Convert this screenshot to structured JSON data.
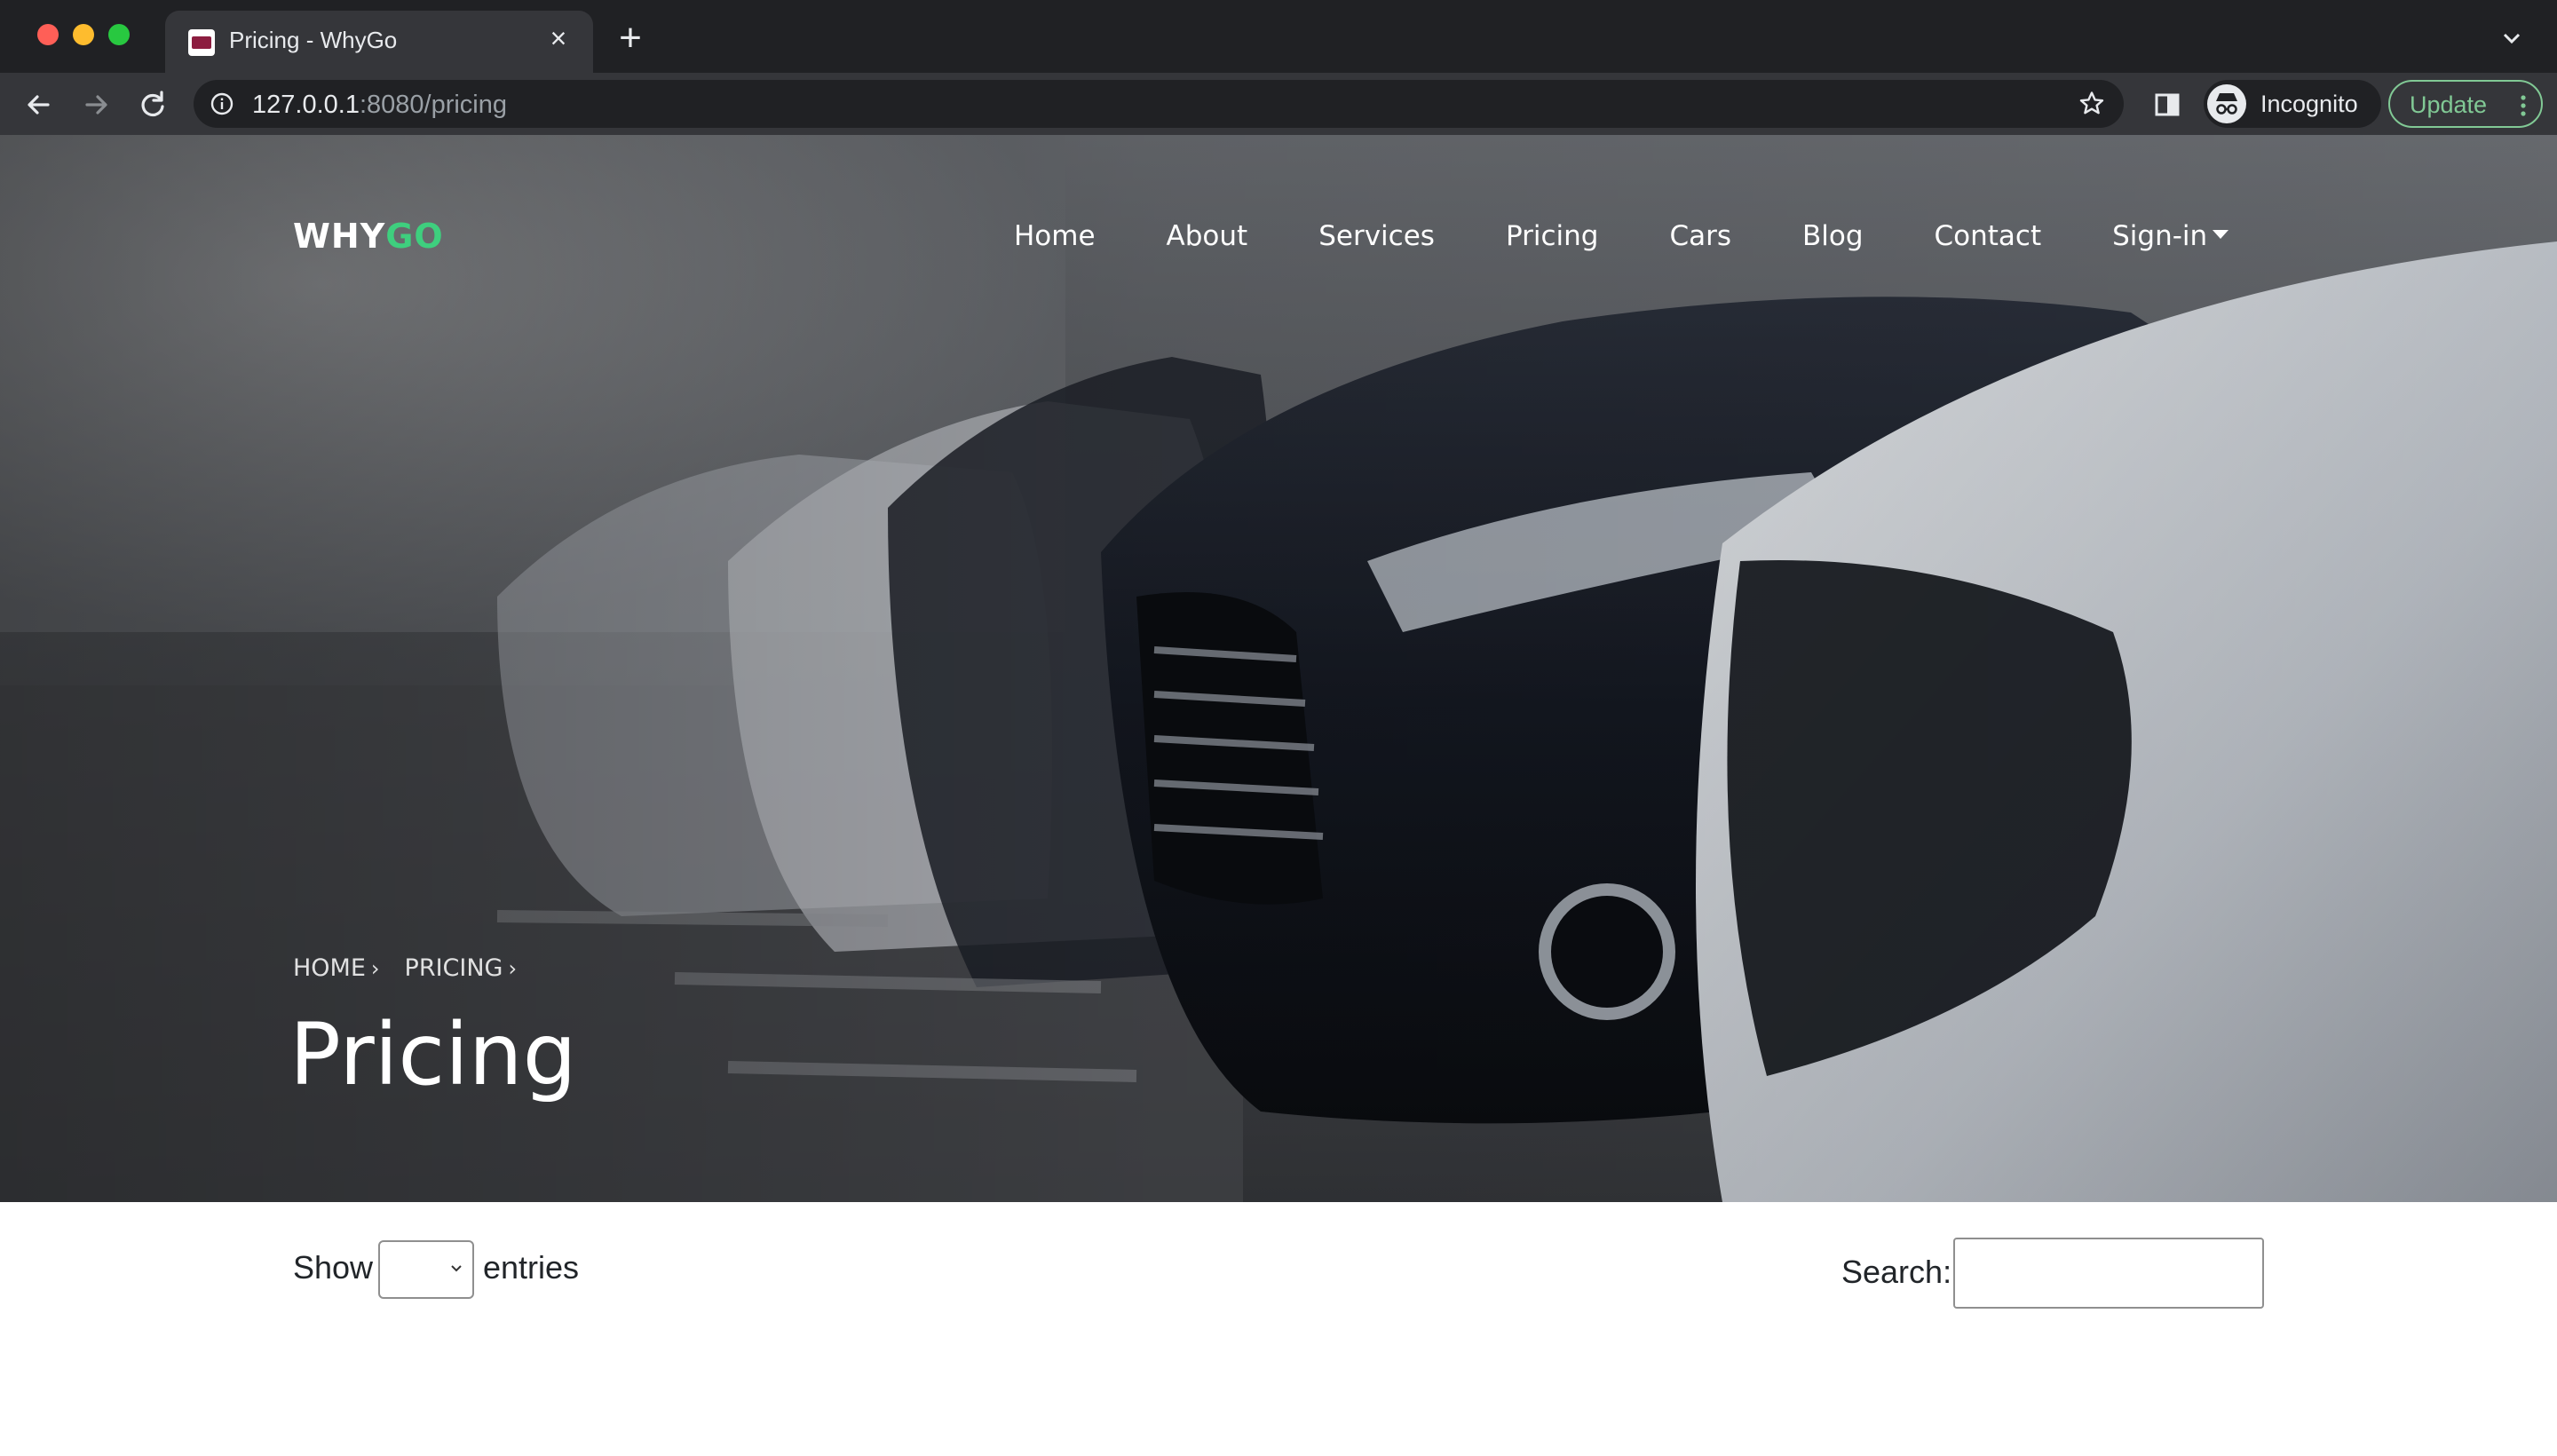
{
  "browser": {
    "tab_title": "Pricing - WhyGo",
    "url_host": "127.0.0.1",
    "url_path": ":8080/pricing",
    "profile_label": "Incognito",
    "update_label": "Update"
  },
  "site": {
    "logo_why": "WHY",
    "logo_go": "GO",
    "accent_color": "#3ecf7e",
    "nav": {
      "home": "Home",
      "about": "About",
      "services": "Services",
      "pricing": "Pricing",
      "cars": "Cars",
      "blog": "Blog",
      "contact": "Contact",
      "signin": "Sign-in"
    }
  },
  "hero": {
    "breadcrumb": [
      "HOME",
      "PRICING"
    ],
    "title": "Pricing"
  },
  "table_controls": {
    "show_label": "Show",
    "entries_label": "entries",
    "length_value": "",
    "search_label": "Search:",
    "search_value": ""
  }
}
